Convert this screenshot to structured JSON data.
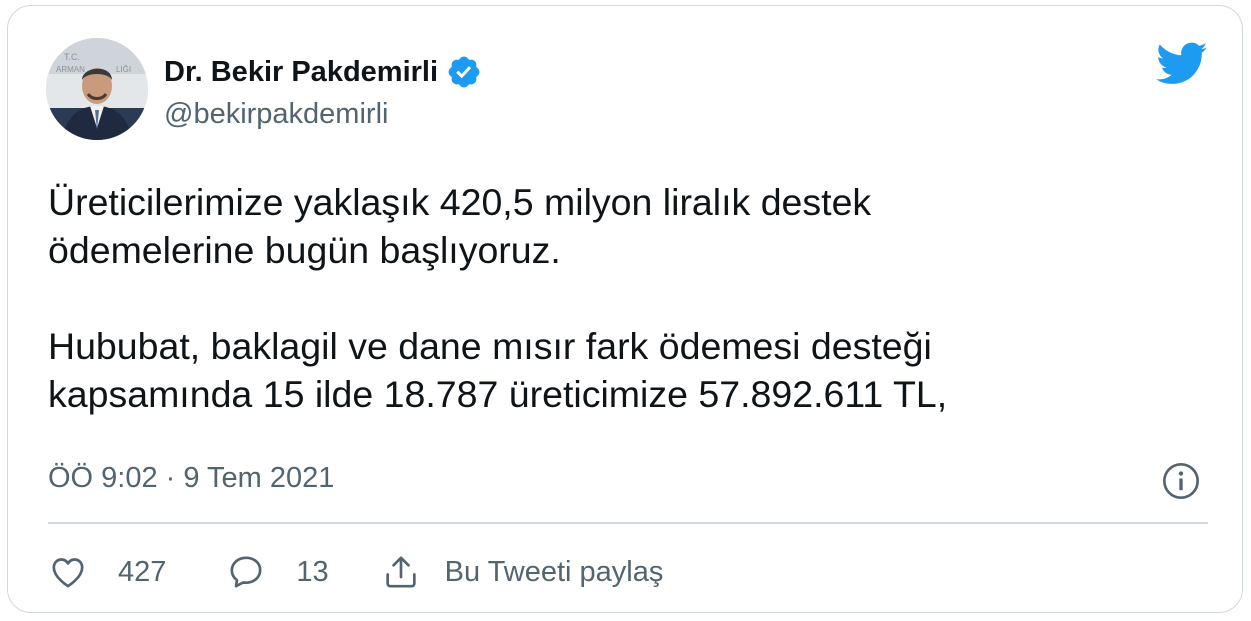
{
  "tweet": {
    "author": {
      "name": "Dr. Bekir Pakdemirli",
      "handle": "@bekirpakdemirli",
      "avatar_alt": "profile-photo"
    },
    "text": "Üreticilerimize yaklaşık 420,5 milyon liralık destek\nödemelerine bugün başlıyoruz.\n\nHububat, baklagil ve dane mısır fark ödemesi desteği\nkapsamında 15 ilde 18.787 üreticimize 57.892.611 TL,",
    "timestamp": "ÖÖ 9:02 · 9 Tem 2021"
  },
  "actions": {
    "likes": "427",
    "replies": "13",
    "share_label": "Bu Tweeti paylaş"
  },
  "icons": {
    "verified": "verified-badge-icon",
    "brand": "twitter-bird-icon",
    "info": "info-icon",
    "like": "heart-icon",
    "reply": "reply-bubble-icon",
    "share": "share-icon"
  },
  "colors": {
    "brand_blue": "#1d9bf0",
    "text_primary": "#0f1419",
    "text_secondary": "#536471",
    "border": "#cfd9de"
  }
}
